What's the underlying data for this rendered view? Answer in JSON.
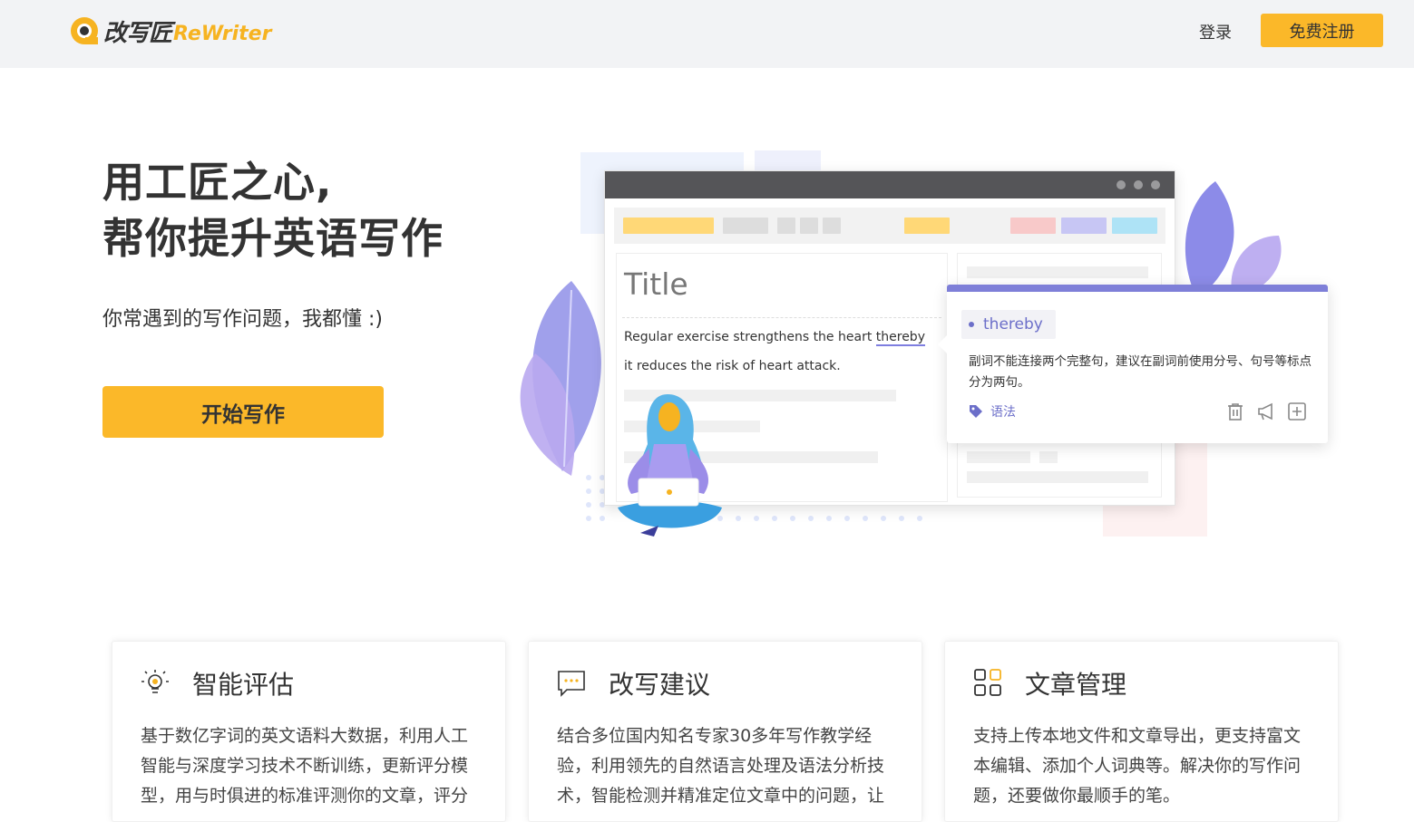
{
  "header": {
    "logo_cn": "改写匠",
    "logo_en": "ReWriter",
    "login_label": "登录",
    "register_label": "免费注册"
  },
  "hero": {
    "title_line1": "用工匠之心,",
    "title_line2": "帮你提升英语写作",
    "subtitle": "你常遇到的写作问题，我都懂 :)",
    "start_button": "开始写作"
  },
  "illustration": {
    "doc_title": "Title",
    "sentence_part1": "Regular exercise strengthens the heart ",
    "sentence_highlight": "thereby",
    "sentence_line2": "it reduces the risk of heart attack.",
    "suggestion_word": "thereby",
    "suggestion_text": "副词不能连接两个完整句，建议在副词前使用分号、句号等标点分为两句。",
    "suggestion_tag": "语法",
    "colors": {
      "accent": "#fbb829",
      "purple": "#7e7fd8",
      "window_bar": "#555558"
    }
  },
  "features": [
    {
      "icon": "lightbulb-icon",
      "title": "智能评估",
      "text": "基于数亿字词的英文语料大数据，利用人工智能与深度学习技术不断训练，更新评分模型，用与时俱进的标准评测你的文章，评分"
    },
    {
      "icon": "chat-bubble-icon",
      "title": "改写建议",
      "text": "结合多位国内知名专家30多年写作教学经验，利用领先的自然语言处理及语法分析技术，智能检测并精准定位文章中的问题，让"
    },
    {
      "icon": "grid-icon",
      "title": "文章管理",
      "text": "支持上传本地文件和文章导出，更支持富文本编辑、添加个人词典等。解决你的写作问题，还要做你最顺手的笔。"
    }
  ]
}
